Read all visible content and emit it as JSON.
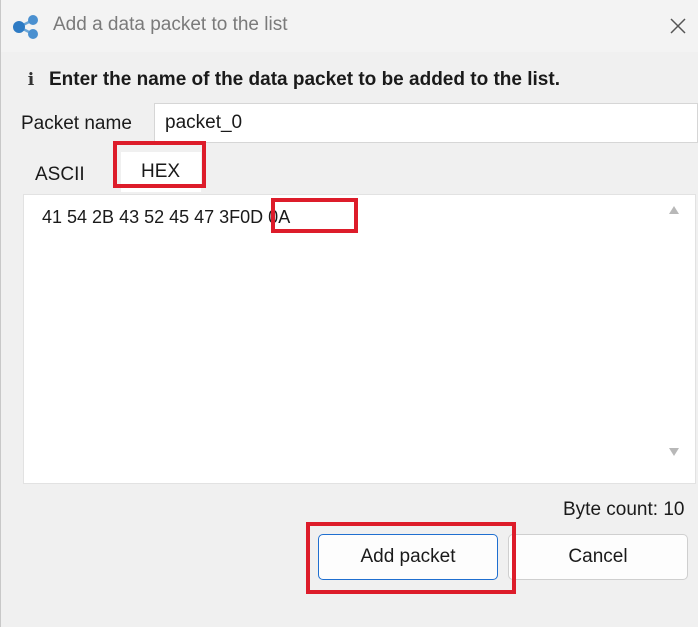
{
  "window": {
    "title": "Add a data packet to the list",
    "app_icon": "network-nodes-icon",
    "close_icon": "close-icon"
  },
  "info": {
    "icon": "info-icon",
    "icon_glyph": "i",
    "message": "Enter the name of the data packet to be added to the list."
  },
  "packet_name": {
    "label": "Packet name",
    "value": "packet_0"
  },
  "tabs": [
    {
      "label": "ASCII",
      "selected": false
    },
    {
      "label": "HEX",
      "selected": true
    }
  ],
  "editor": {
    "content_before": "41 54 2B 43 52 45 47 3F",
    "content_highlight": "0D 0A"
  },
  "byte_count": "Byte count: 10",
  "buttons": {
    "add": "Add packet",
    "cancel": "Cancel"
  },
  "colors": {
    "highlight": "#dd1c2a",
    "accent": "#1f6fd0"
  }
}
